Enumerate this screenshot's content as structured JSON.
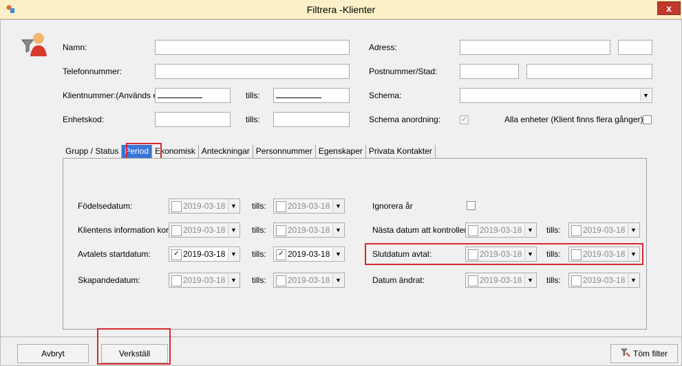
{
  "window": {
    "title": "Filtrera -Klienter",
    "close": "x"
  },
  "fields": {
    "namn": "Namn:",
    "adress": "Adress:",
    "telefon": "Telefonnummer:",
    "postnr": "Postnummer/Stad:",
    "klientnr": "Klientnummer:(Används e",
    "schema": "Schema:",
    "enhetskod": "Enhetskod:",
    "schema_anordning": "Schema anordning:",
    "alla_enheter": "Alla enheter (Klient finns flera gånger)",
    "tills": "tills:"
  },
  "tabs": [
    "Grupp / Status",
    "Period",
    "Ekonomisk",
    "Anteckningar",
    "Personnummer",
    "Egenskaper",
    "Privata Kontakter"
  ],
  "period": {
    "fodelsedatum": "Födelsedatum:",
    "klientens_info": "Klientens information kont",
    "avtalets_start": "Avtalets startdatum:",
    "skapandedatum": "Skapandedatum:",
    "ignorera_ar": "Ignorera år",
    "nasta_datum": "Nästa datum att kontroller",
    "slutdatum": "Slutdatum avtal:",
    "datum_andrat": "Datum ändrat:",
    "date": "2019-03-18",
    "tills": "tills:"
  },
  "buttons": {
    "avbryt": "Avbryt",
    "verkstall": "Verkställ",
    "tom_filter": "Töm filter"
  },
  "colors": {
    "titlebar": "#fbf0c8",
    "highlight": "#d9272e",
    "tab_selected": "#3874d8"
  }
}
